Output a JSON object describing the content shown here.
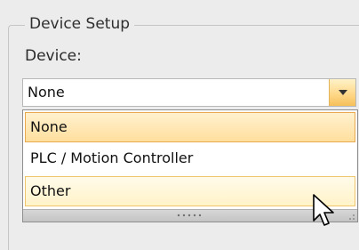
{
  "group": {
    "title": "Device Setup"
  },
  "device": {
    "label": "Device:",
    "selected_value": "None",
    "dropdown_icon": "chevron-down-icon",
    "options": [
      {
        "label": "None",
        "state": "selected"
      },
      {
        "label": "PLC / Motion Controller",
        "state": "normal"
      },
      {
        "label": "Other",
        "state": "hover"
      }
    ]
  },
  "colors": {
    "window_bg": "#ececec",
    "selected_border": "#e9a94e",
    "selected_fill": "#ffdf9d",
    "hover_fill": "#fff3c8"
  },
  "icons": {
    "pointer": "mouse-pointer-icon",
    "resize_grip": "resize-grip-icon"
  }
}
